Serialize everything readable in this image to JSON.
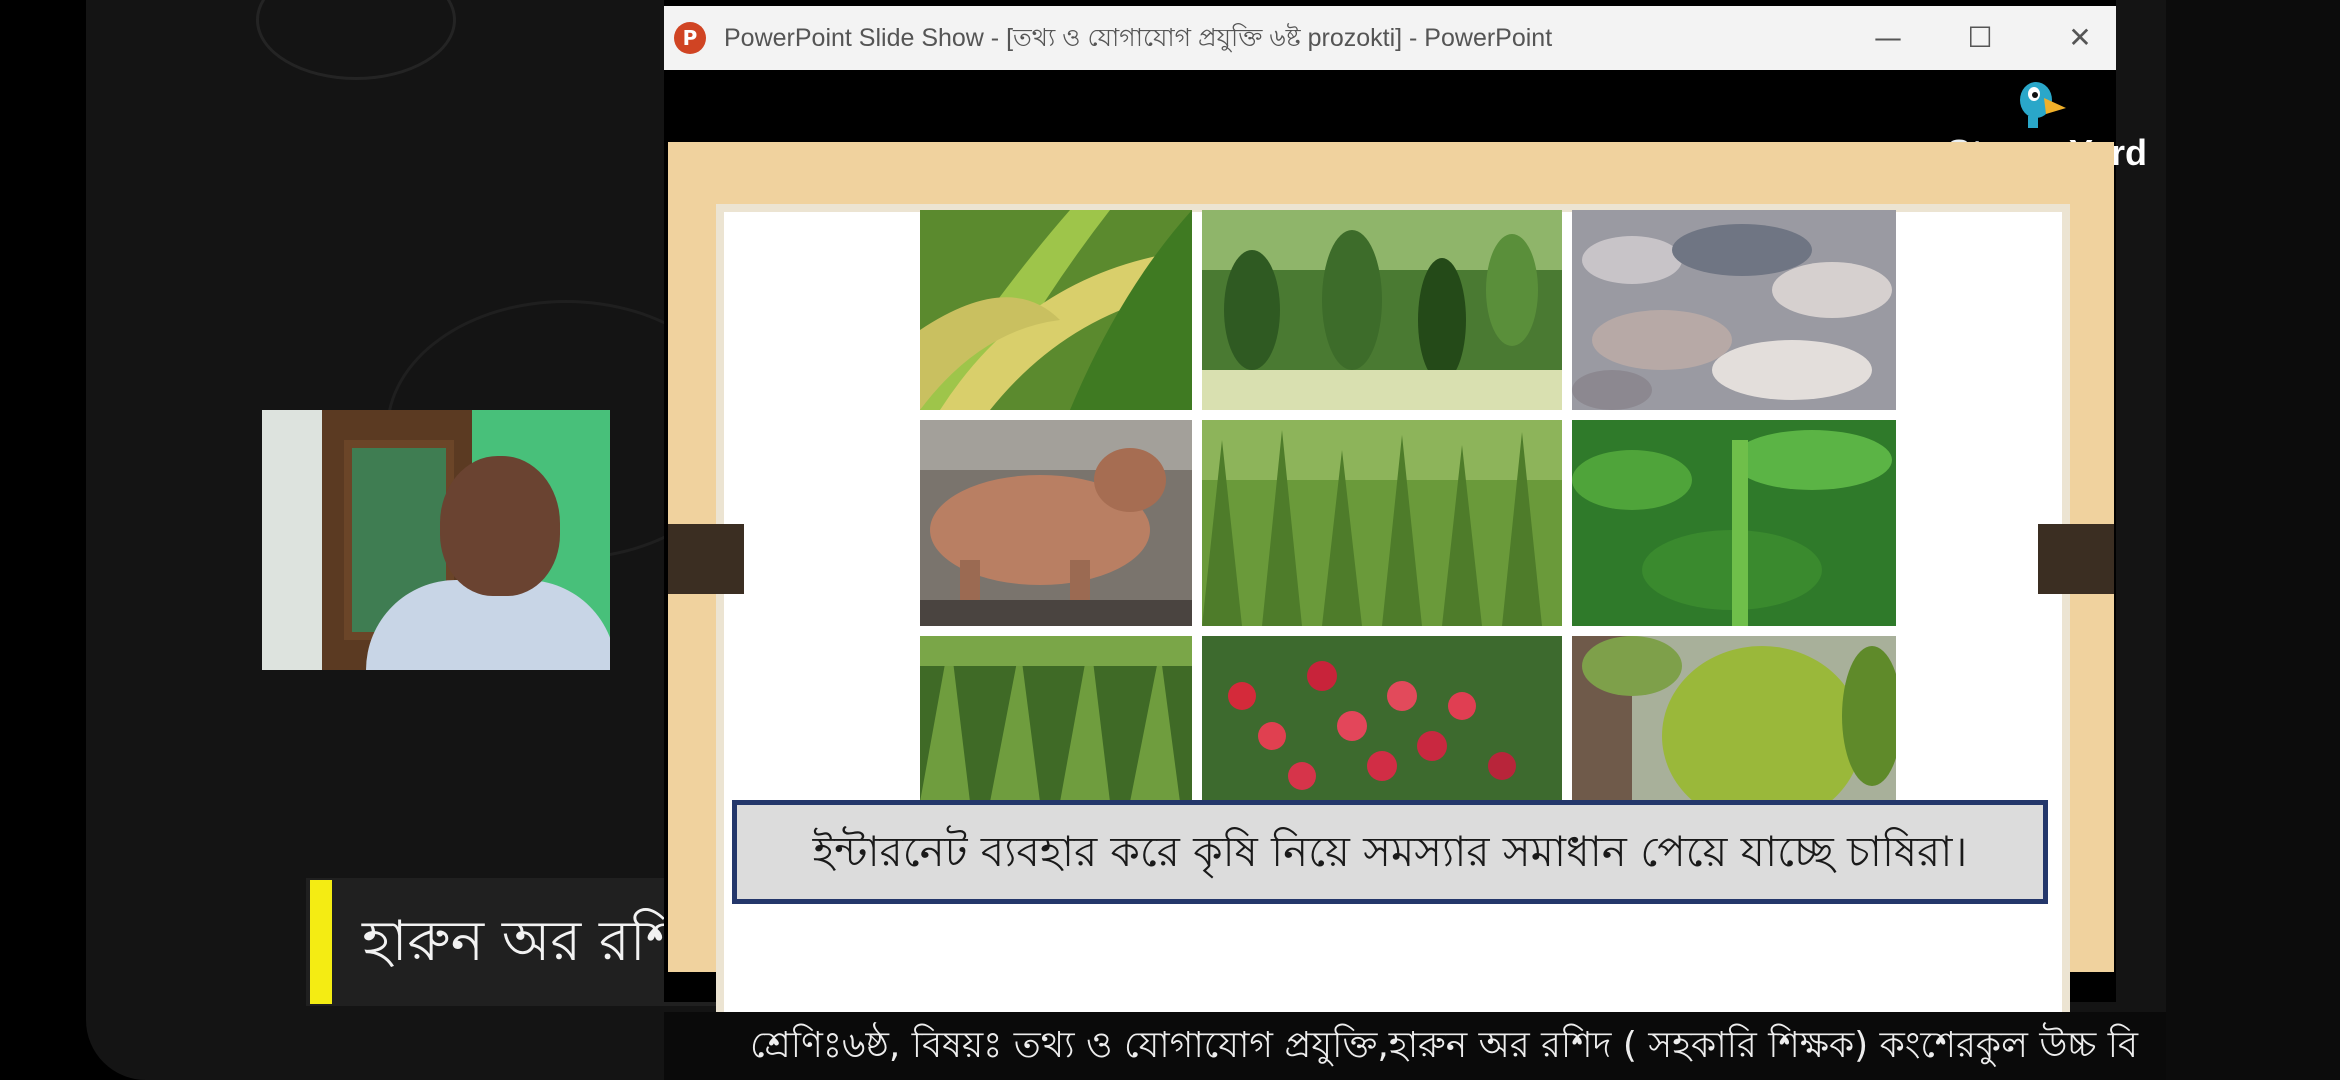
{
  "window": {
    "title": "PowerPoint Slide Show - [তথ্য ও যোগাযোগ প্রযুক্তি ৬ষ্ট prozokti] - PowerPoint",
    "icon": "powerpoint-icon",
    "minimize_glyph": "—",
    "maximize_glyph": "☐",
    "close_glyph": "✕"
  },
  "watermark": {
    "brand_a": "Stream",
    "brand_b": "Yard",
    "icon": "streamyard-logo"
  },
  "presenter": {
    "name": "হারুন অর রশিদ",
    "accent_color": "#f4ec13"
  },
  "slide": {
    "caption": "ইন্টারনেট ব্যবহার করে কৃষি নিয়ে সমস্যার সমাধান পেয়ে যাচ্ছে চাষিরা।",
    "tiles": [
      "rice-photo",
      "okra-photo",
      "fish-photo",
      "cattle-photo",
      "wheat-photo",
      "plant-photo",
      "maize-photo",
      "lychee-photo",
      "jackfruit-photo"
    ]
  },
  "ticker": {
    "text": "শ্রেণিঃ৬ষ্ঠ, বিষয়ঃ তথ্য ও যোগাযোগ প্রযুক্তি,হারুন অর রশিদ ( সহকারি শিক্ষক) কংশেরকুল উচ্চ বি"
  },
  "colors": {
    "slide_frame": "#f0d29e",
    "caption_border": "#24376b",
    "titlebar": "#f3f3f3"
  }
}
